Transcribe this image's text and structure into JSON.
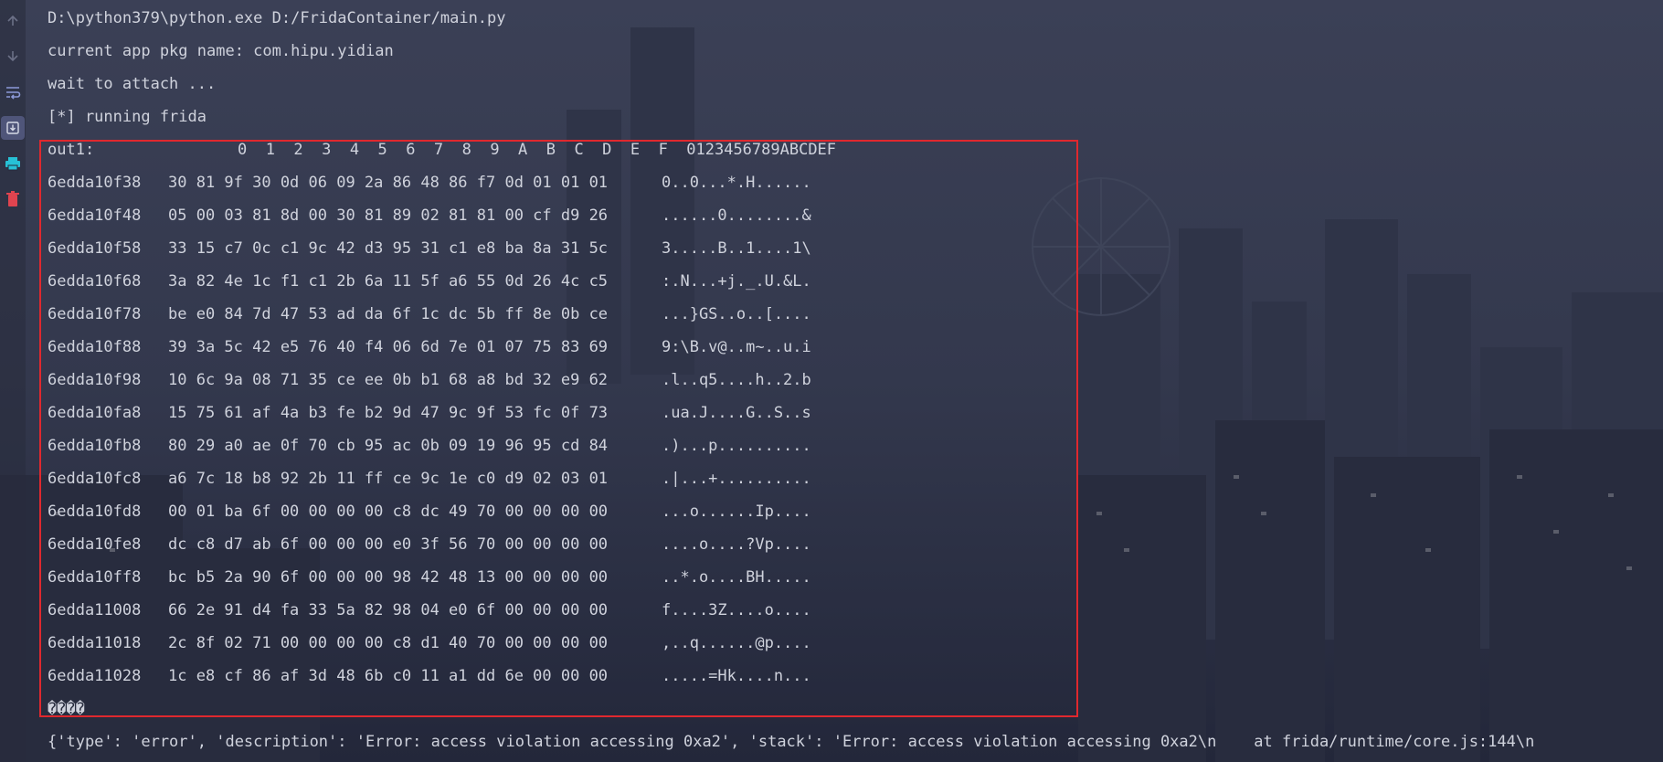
{
  "console": {
    "header_lines": [
      "D:\\python379\\python.exe D:/FridaContainer/main.py",
      "current app pkg name: com.hipu.yidian",
      "wait to attach ...",
      "[*] running frida"
    ],
    "hexdump_label": "out1:",
    "hexdump_columns": "0  1  2  3  4  5  6  7  8  9  A  B  C  D  E  F  0123456789ABCDEF",
    "hexdump_rows": [
      {
        "addr": "6edda10f38",
        "bytes": "30 81 9f 30 0d 06 09 2a 86 48 86 f7 0d 01 01 01",
        "ascii": "0..0...*.H......"
      },
      {
        "addr": "6edda10f48",
        "bytes": "05 00 03 81 8d 00 30 81 89 02 81 81 00 cf d9 26",
        "ascii": "......0........&"
      },
      {
        "addr": "6edda10f58",
        "bytes": "33 15 c7 0c c1 9c 42 d3 95 31 c1 e8 ba 8a 31 5c",
        "ascii": "3.....B..1....1\\"
      },
      {
        "addr": "6edda10f68",
        "bytes": "3a 82 4e 1c f1 c1 2b 6a 11 5f a6 55 0d 26 4c c5",
        "ascii": ":.N...+j._.U.&L."
      },
      {
        "addr": "6edda10f78",
        "bytes": "be e0 84 7d 47 53 ad da 6f 1c dc 5b ff 8e 0b ce",
        "ascii": "...}GS..o..[...."
      },
      {
        "addr": "6edda10f88",
        "bytes": "39 3a 5c 42 e5 76 40 f4 06 6d 7e 01 07 75 83 69",
        "ascii": "9:\\B.v@..m~..u.i"
      },
      {
        "addr": "6edda10f98",
        "bytes": "10 6c 9a 08 71 35 ce ee 0b b1 68 a8 bd 32 e9 62",
        "ascii": ".l..q5....h..2.b"
      },
      {
        "addr": "6edda10fa8",
        "bytes": "15 75 61 af 4a b3 fe b2 9d 47 9c 9f 53 fc 0f 73",
        "ascii": ".ua.J....G..S..s"
      },
      {
        "addr": "6edda10fb8",
        "bytes": "80 29 a0 ae 0f 70 cb 95 ac 0b 09 19 96 95 cd 84",
        "ascii": ".)...p.........."
      },
      {
        "addr": "6edda10fc8",
        "bytes": "a6 7c 18 b8 92 2b 11 ff ce 9c 1e c0 d9 02 03 01",
        "ascii": ".|...+.........."
      },
      {
        "addr": "6edda10fd8",
        "bytes": "00 01 ba 6f 00 00 00 00 c8 dc 49 70 00 00 00 00",
        "ascii": "...o......Ip...."
      },
      {
        "addr": "6edda10fe8",
        "bytes": "dc c8 d7 ab 6f 00 00 00 e0 3f 56 70 00 00 00 00",
        "ascii": "....o....?Vp...."
      },
      {
        "addr": "6edda10ff8",
        "bytes": "bc b5 2a 90 6f 00 00 00 98 42 48 13 00 00 00 00",
        "ascii": "..*.o....BH....."
      },
      {
        "addr": "6edda11008",
        "bytes": "66 2e 91 d4 fa 33 5a 82 98 04 e0 6f 00 00 00 00",
        "ascii": "f....3Z....o...."
      },
      {
        "addr": "6edda11018",
        "bytes": "2c 8f 02 71 00 00 00 00 c8 d1 40 70 00 00 00 00",
        "ascii": ",..q......@p...."
      },
      {
        "addr": "6edda11028",
        "bytes": "1c e8 cf 86 af 3d 48 6b c0 11 a1 dd 6e 00 00 00",
        "ascii": ".....=Hk....n..."
      }
    ],
    "garbled_line": "����",
    "error_line": "{'type': 'error', 'description': 'Error: access violation accessing 0xa2', 'stack': 'Error: access violation accessing 0xa2\\n    at frida/runtime/core.js:144\\n"
  },
  "gutter": {
    "icons": [
      "arrow-up-icon",
      "arrow-down-icon",
      "soft-wrap-icon",
      "scroll-to-end-icon",
      "print-icon",
      "trash-icon"
    ]
  },
  "colors": {
    "highlight_border": "#e0282e",
    "print_icon": "#27c1d6",
    "trash_icon": "#e0444f",
    "text": "#cfd2dc"
  }
}
